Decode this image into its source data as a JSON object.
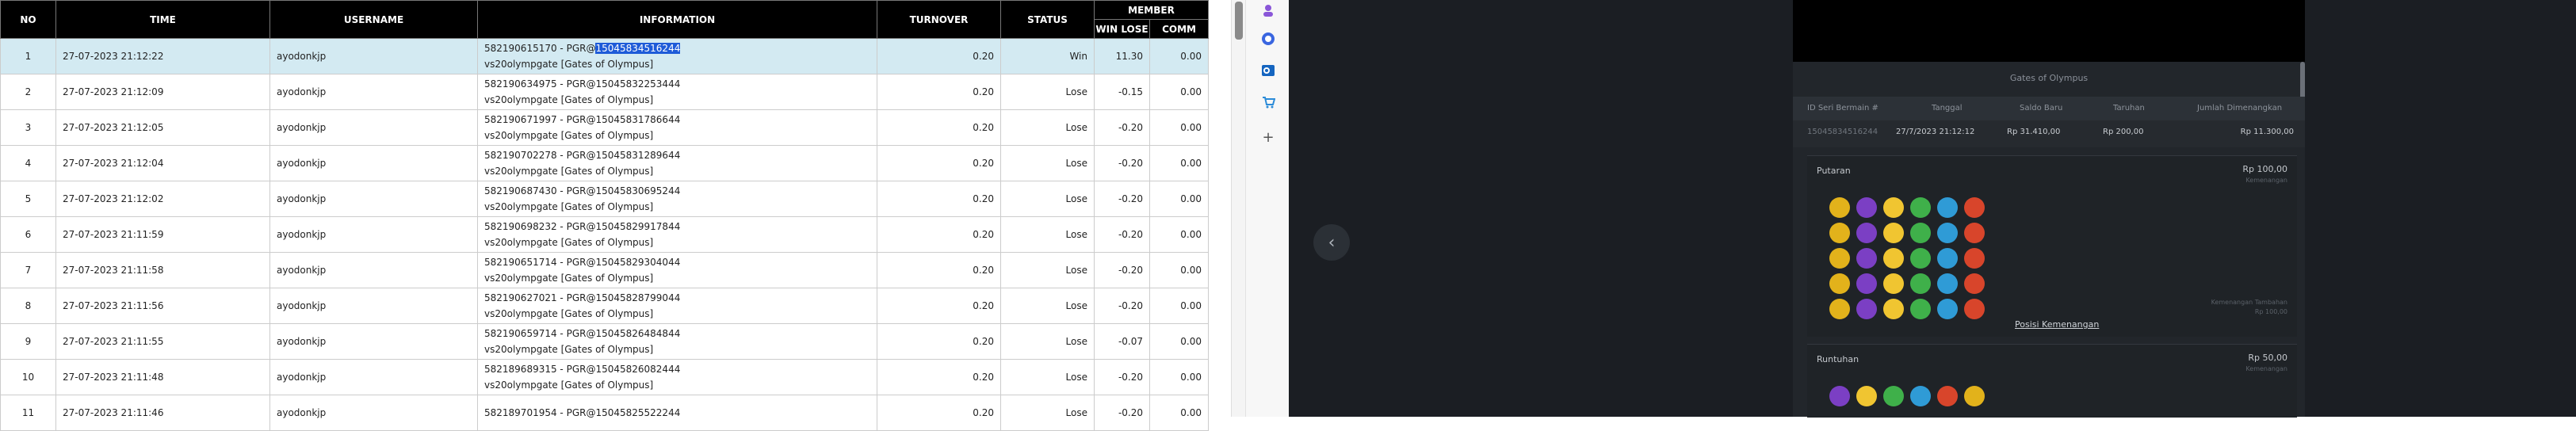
{
  "report": {
    "columns": {
      "no": "NO",
      "time": "TIME",
      "username": "USERNAME",
      "information": "INFORMATION",
      "turnover": "TURNOVER",
      "status": "STATUS",
      "member": "MEMBER",
      "winlose": "WIN LOSE",
      "comm": "COMM"
    },
    "rows": [
      {
        "no": "1",
        "time": "27-07-2023 21:12:22",
        "user": "ayodonkjp",
        "info_prefix": "582190615170 - PGR@",
        "info_hl": "15045834516244",
        "info2": "vs20olympgate [Gates of Olympus]",
        "turnover": "0.20",
        "status": "Win",
        "winlose": "11.30",
        "comm": "0.00"
      },
      {
        "no": "2",
        "time": "27-07-2023 21:12:09",
        "user": "ayodonkjp",
        "info_prefix": "582190634975 - PGR@15045832253444",
        "info_hl": "",
        "info2": "vs20olympgate [Gates of Olympus]",
        "turnover": "0.20",
        "status": "Lose",
        "winlose": "-0.15",
        "comm": "0.00"
      },
      {
        "no": "3",
        "time": "27-07-2023 21:12:05",
        "user": "ayodonkjp",
        "info_prefix": "582190671997 - PGR@15045831786644",
        "info_hl": "",
        "info2": "vs20olympgate [Gates of Olympus]",
        "turnover": "0.20",
        "status": "Lose",
        "winlose": "-0.20",
        "comm": "0.00"
      },
      {
        "no": "4",
        "time": "27-07-2023 21:12:04",
        "user": "ayodonkjp",
        "info_prefix": "582190702278 - PGR@15045831289644",
        "info_hl": "",
        "info2": "vs20olympgate [Gates of Olympus]",
        "turnover": "0.20",
        "status": "Lose",
        "winlose": "-0.20",
        "comm": "0.00"
      },
      {
        "no": "5",
        "time": "27-07-2023 21:12:02",
        "user": "ayodonkjp",
        "info_prefix": "582190687430 - PGR@15045830695244",
        "info_hl": "",
        "info2": "vs20olympgate [Gates of Olympus]",
        "turnover": "0.20",
        "status": "Lose",
        "winlose": "-0.20",
        "comm": "0.00"
      },
      {
        "no": "6",
        "time": "27-07-2023 21:11:59",
        "user": "ayodonkjp",
        "info_prefix": "582190698232 - PGR@15045829917844",
        "info_hl": "",
        "info2": "vs20olympgate [Gates of Olympus]",
        "turnover": "0.20",
        "status": "Lose",
        "winlose": "-0.20",
        "comm": "0.00"
      },
      {
        "no": "7",
        "time": "27-07-2023 21:11:58",
        "user": "ayodonkjp",
        "info_prefix": "582190651714 - PGR@15045829304044",
        "info_hl": "",
        "info2": "vs20olympgate [Gates of Olympus]",
        "turnover": "0.20",
        "status": "Lose",
        "winlose": "-0.20",
        "comm": "0.00"
      },
      {
        "no": "8",
        "time": "27-07-2023 21:11:56",
        "user": "ayodonkjp",
        "info_prefix": "582190627021 - PGR@15045828799044",
        "info_hl": "",
        "info2": "vs20olympgate [Gates of Olympus]",
        "turnover": "0.20",
        "status": "Lose",
        "winlose": "-0.20",
        "comm": "0.00"
      },
      {
        "no": "9",
        "time": "27-07-2023 21:11:55",
        "user": "ayodonkjp",
        "info_prefix": "582190659714 - PGR@15045826484844",
        "info_hl": "",
        "info2": "vs20olympgate [Gates of Olympus]",
        "turnover": "0.20",
        "status": "Lose",
        "winlose": "-0.07",
        "comm": "0.00"
      },
      {
        "no": "10",
        "time": "27-07-2023 21:11:48",
        "user": "ayodonkjp",
        "info_prefix": "582189689315 - PGR@15045826082444",
        "info_hl": "",
        "info2": "vs20olympgate [Gates of Olympus]",
        "turnover": "0.20",
        "status": "Lose",
        "winlose": "-0.20",
        "comm": "0.00"
      },
      {
        "no": "11",
        "time": "27-07-2023 21:11:46",
        "user": "ayodonkjp",
        "info_prefix": "582189701954 - PGR@15045825522244",
        "info_hl": "",
        "info2": "",
        "turnover": "0.20",
        "status": "Lose",
        "winlose": "-0.20",
        "comm": "0.00"
      }
    ]
  },
  "game_detail": {
    "title": "Gates of Olympus",
    "headers": {
      "round_id": "ID Seri Bermain #",
      "date": "Tanggal",
      "new_balance": "Saldo Baru",
      "bet": "Taruhan",
      "total_win": "Jumlah Dimenangkan"
    },
    "values": {
      "round_id": "15045834516244",
      "date": "27/7/2023 21:12:12",
      "new_balance": "Rp 31.410,00",
      "bet": "Rp 200,00",
      "total_win": "Rp 11.300,00"
    },
    "spin": {
      "label": "Putaran",
      "amount": "Rp 100,00",
      "sub": "Kemenangan",
      "payout_label": "Kemenangan Tambahan",
      "payout_value": "Rp 100,00",
      "link": "Posisi Kemenangan"
    },
    "tumble": {
      "label": "Runtuhan",
      "amount": "Rp 50,00",
      "sub": "Kemenangan"
    },
    "gem_colors": [
      "#7b3fc4",
      "#e2b21b",
      "#d8452b",
      "#2f9bd6",
      "#3fb04a",
      "#f0c531"
    ]
  },
  "sidebar_icons": [
    "person-icon",
    "copilot-icon",
    "outlook-icon",
    "shopping-icon",
    "add-icon"
  ]
}
